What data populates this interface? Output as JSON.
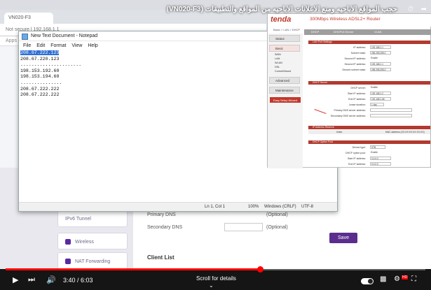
{
  "video": {
    "title": "حجب المواقع الاباحيه ومنع الاعلانات الاباحيه من المواقع والتطبيقات (VN020-F3)",
    "time_current": "3:40",
    "time_total": "6:03",
    "time_sep": " / ",
    "progress_fraction": 0.606,
    "scroll_hint": "Scroll for details",
    "accent": "#ff0000"
  },
  "bg_browser": {
    "tab_label": "VN020-F3",
    "address": "Not secure | 192.168.1.1",
    "bookmarks_label": "Apps",
    "sidebar_items": [
      {
        "label": "IPv6 Tunnel"
      },
      {
        "label": "Wireless"
      },
      {
        "label": "NAT Forwarding"
      }
    ],
    "fields": [
      {
        "label": "Primary DNS",
        "hint": "(Optional)"
      },
      {
        "label": "Secondary DNS",
        "hint": "(Optional)"
      }
    ],
    "save_label": "Save",
    "client_list_label": "Client List",
    "save_color": "#5b2d8e"
  },
  "notepad": {
    "title": "New Text Document - Notepad",
    "menu": [
      "File",
      "Edit",
      "Format",
      "View",
      "Help"
    ],
    "lines": [
      "208.67.222.123",
      "208.67.220.123",
      "......................",
      "198.153.192.60",
      "198.153.194.60",
      "...............",
      "208.67.222.222",
      "208.67.222.222"
    ],
    "status": {
      "position": "Ln 1, Col 1",
      "zoom": "100%",
      "line_ending": "Windows (CRLF)",
      "encoding": "UTF-8"
    }
  },
  "router": {
    "logo": "tenda",
    "model": "300Mbps Wireless ADSL2+ Router",
    "breadcrumb": "Basic > LAN > DHCP",
    "tabs": [
      "DHCP",
      "DHCPv6 Server",
      "VLAN"
    ],
    "nav": [
      "Status",
      "Basic",
      "Advanced",
      "Maintenance"
    ],
    "nav_sub": [
      "WAN",
      "LAN",
      "WLAN",
      "DSL",
      "CommWizard"
    ],
    "setup_label": "Easy Setup Wizard",
    "lan_section": "LAN Port Settings",
    "lan_rows": [
      {
        "label": "IP address:",
        "value": "192.168.1.1"
      },
      {
        "label": "Subnet mask:",
        "value": "255.255.255.0"
      },
      {
        "label": "Second IP address:",
        "value": "Enable"
      },
      {
        "label": "Second IP address:",
        "value": "192.168.1.1"
      },
      {
        "label": "Second subnet mask:",
        "value": "255.255.255.0"
      }
    ],
    "dhcp_section": "DHCP Server",
    "dhcp_rows": [
      {
        "label": "DHCP server:",
        "value": "Enable"
      },
      {
        "label": "Start IP address:",
        "value": "192.168.1.2"
      },
      {
        "label": "End IP address:",
        "value": "192.168.1.66"
      },
      {
        "label": "Lease duration:",
        "value": "1 day"
      },
      {
        "label": "Primary DNS server address:",
        "value": ""
      },
      {
        "label": "Secondary DNS server address:",
        "value": ""
      }
    ],
    "reserve_section": "IP Address Reserve",
    "reserve_cols": [
      "Index",
      "MAC address (XX:XX:XX:XX:XX:XX)"
    ],
    "option_section": "DHCP Option Pool",
    "option_rows": [
      {
        "label": "Device type:",
        "value": "STB"
      },
      {
        "label": "DHCP option pool:",
        "value": "Enable"
      },
      {
        "label": "Start IP address:",
        "value": "0.0.0.0"
      },
      {
        "label": "End IP address:",
        "value": "0.0.0.0"
      }
    ],
    "brand_color": "#c0392b"
  }
}
